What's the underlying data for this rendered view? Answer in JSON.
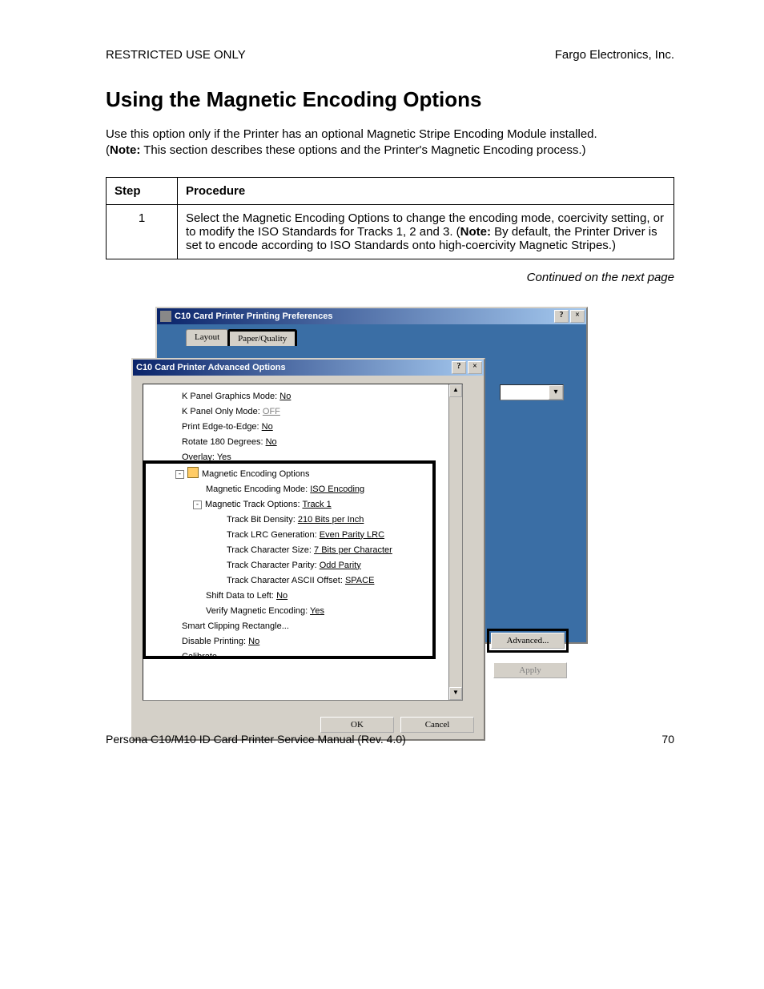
{
  "header": {
    "left": "RESTRICTED USE ONLY",
    "right": "Fargo Electronics, Inc."
  },
  "title": "Using the Magnetic Encoding Options",
  "intro": {
    "line1": "Use this option only if the Printer has an optional Magnetic Stripe Encoding Module installed.",
    "note_prefix": "(",
    "note_bold": "Note:",
    "note_rest": "  This section describes these options and the Printer's Magnetic Encoding process.)"
  },
  "table": {
    "head_step": "Step",
    "head_proc": "Procedure",
    "row1_step": "1",
    "row1_a": "Select the Magnetic Encoding Options to change the encoding mode, coercivity setting, or to modify the ISO Standards for Tracks 1, 2 and 3. (",
    "row1_bold": "Note:",
    "row1_b": " By default, the Printer Driver is set to encode according to ISO Standards onto high-coercivity Magnetic Stripes.)"
  },
  "continued": "Continued on the next page",
  "outer_window": {
    "title": "C10 Card Printer Printing Preferences",
    "tab_layout": "Layout",
    "tab_paper": "Paper/Quality",
    "btn_advanced": "Advanced...",
    "btn_apply": "Apply"
  },
  "inner_window": {
    "title": "C10 Card Printer Advanced Options",
    "btn_ok": "OK",
    "btn_cancel": "Cancel"
  },
  "tree": {
    "r1_label": "K Panel Graphics Mode: ",
    "r1_val": "No",
    "r2_label": "K Panel Only Mode: ",
    "r2_val": "OFF",
    "r3_label": "Print Edge-to-Edge: ",
    "r3_val": "No",
    "r4_label": "Rotate 180 Degrees: ",
    "r4_val": "No",
    "r5_label": "Overlay: ",
    "r5_val": "Yes",
    "r6_label": "Magnetic Encoding Options",
    "r7_label": "Magnetic Encoding Mode: ",
    "r7_val": "ISO Encoding",
    "r8_label": "Magnetic Track Options: ",
    "r8_val": "Track 1",
    "r9_label": "Track Bit Density: ",
    "r9_val": "210 Bits per Inch",
    "r10_label": "Track LRC Generation: ",
    "r10_val": "Even Parity LRC",
    "r11_label": "Track Character Size: ",
    "r11_val": "7 Bits per Character",
    "r12_label": "Track Character Parity: ",
    "r12_val": "Odd Parity",
    "r13_label": "Track Character ASCII Offset: ",
    "r13_val": "SPACE",
    "r14_label": "Shift Data to Left: ",
    "r14_val": "No",
    "r15_label": "Verify Magnetic Encoding: ",
    "r15_val": "Yes",
    "r16_label": "Smart Clipping Rectangle...",
    "r17_label": "Disable Printing: ",
    "r17_val": "No",
    "r18_label": "Calibrate..."
  },
  "footer": {
    "left": "Persona C10/M10 ID Card Printer Service Manual (Rev. 4.0)",
    "right": "70"
  }
}
